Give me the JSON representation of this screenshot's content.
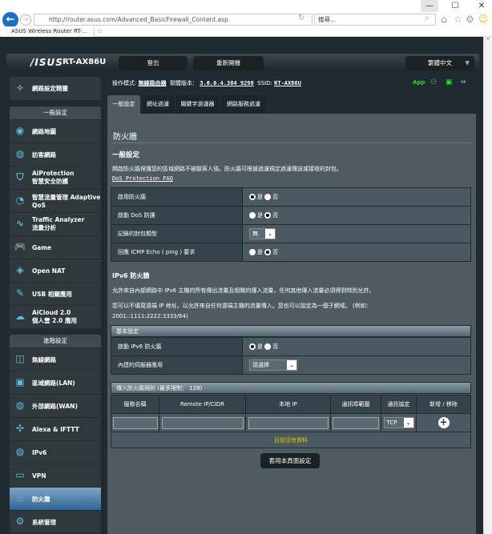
{
  "browser": {
    "url": "http://router.asus.com/Advanced_BasicFirewall_Content.asp",
    "search_placeholder": "搜尋...",
    "tab_title": "ASUS Wireless Router RT-...",
    "minimize": "—",
    "maximize": "☐",
    "close": "✕"
  },
  "header": {
    "logo": "/ISUS",
    "model": "RT-AX86U",
    "logout": "登出",
    "reboot": "重新開機",
    "language": "繁體中文"
  },
  "info": {
    "mode_label": "操作模式:",
    "mode": "無線路由器",
    "fw_label": "韌體版本：",
    "fw": "3.0.0.4.384_9298",
    "ssid_label": "SSID:",
    "ssid": "RT-AX86U",
    "app": "App"
  },
  "sidebar": {
    "quick": "網路設定精靈",
    "general_title": "一般設定",
    "general": [
      {
        "l1": "網路地圖"
      },
      {
        "l1": "訪客網路"
      },
      {
        "l1": "AiProtection",
        "l2": "智慧安全防護"
      },
      {
        "l1": "智慧流量管理 Adaptive",
        "l2": "QoS"
      },
      {
        "l1": "Traffic Analyzer",
        "l2": "流量分析"
      },
      {
        "l1": "Game"
      },
      {
        "l1": "Open NAT"
      },
      {
        "l1": "USB 相關應用"
      },
      {
        "l1": "AiCloud 2.0",
        "l2": "個人雲 2.0 應用"
      }
    ],
    "advanced_title": "進階設定",
    "advanced": [
      {
        "l1": "無線網路"
      },
      {
        "l1": "區域網路(LAN)"
      },
      {
        "l1": "外部網路(WAN)"
      },
      {
        "l1": "Alexa & IFTTT"
      },
      {
        "l1": "IPv6"
      },
      {
        "l1": "VPN"
      },
      {
        "l1": "防火牆"
      },
      {
        "l1": "系統管理"
      }
    ]
  },
  "tabs": [
    "一般設定",
    "網址過濾",
    "關鍵字過濾器",
    "網路服務過濾"
  ],
  "main": {
    "title": "防火牆",
    "general_heading": "一般設定",
    "general_desc": "開啟防火牆保護您的區域網路不被駭客入侵。防火牆可根據過濾規定過濾傳送或接收的封包。",
    "faq_link": "DoS Protection FAQ",
    "yes": "是",
    "no": "否",
    "rows": [
      {
        "label": "啟用防火牆"
      },
      {
        "label": "啟動 DoS 防護"
      },
      {
        "label": "記錄的封包類型",
        "value": "無"
      },
      {
        "label": "回應 ICMP Echo ( ping ) 要求"
      }
    ],
    "ipv6_heading": "IPv6 防火牆",
    "ipv6_desc1": "允許來自內部網路中 IPv6 主機的所有傳出流量及相關的傳入流量，任何其他傳入流量必須得到特別允許。",
    "ipv6_desc2": "您可以不填寫遠端 IP 地址，以允許來自任何遠端主機的流量傳入。您也可以設定為一個子網域。 (例如：2001::1111:2222:3333/64)",
    "basic_title": "基本設定",
    "ipv6_rows": [
      {
        "label": "啟動 IPv6 防火牆"
      },
      {
        "label": "內建的伺服器應用",
        "value": "請選擇"
      }
    ],
    "rules_title": "傳入防火牆規則 (最多限制： 128)",
    "columns": [
      "服務名稱",
      "Remote IP/CIDR",
      "本地 IP",
      "通訊埠範圍",
      "通訊協定",
      "新增 / 移除"
    ],
    "protocol": "TCP",
    "empty": "目前沒有資料",
    "apply": "套用本頁面設定"
  }
}
